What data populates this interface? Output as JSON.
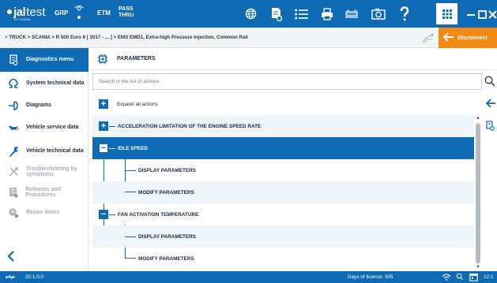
{
  "app": {
    "logo_main": "jal",
    "logo_rest": "test",
    "logo_sub": "BY CORAIL",
    "grp_label": "GRP",
    "etm_label": "ETM",
    "pass_line1": "PASS",
    "pass_line2": "THRU"
  },
  "toolbar_icons": [
    "globe-icon",
    "document-settings-icon",
    "list-icon",
    "print-icon",
    "battery-icon",
    "camera-icon",
    "help-icon",
    "grid-icon",
    "minimize-icon",
    "maximize-icon",
    "close-icon"
  ],
  "breadcrumb": {
    "prefix": "> ",
    "path": "TRUCK  >  SCANIA  >  R 500 Euro 6 [ 2017 - ... ]  >  EMS EMD1, Extra-high Pressure Injection, Common Rail"
  },
  "disconnect_label": "Disconnect",
  "sidebar": {
    "items": [
      {
        "label": "Diagnostics menu",
        "icon": "diagnostics-icon",
        "state": "active"
      },
      {
        "label": "System technical data",
        "icon": "ohm-icon",
        "state": "normal"
      },
      {
        "label": "Diagrams",
        "icon": "diagram-icon",
        "state": "normal"
      },
      {
        "label": "Vehicle service data",
        "icon": "oil-can-icon",
        "state": "normal"
      },
      {
        "label": "Vehicle technical data",
        "icon": "wrench-icon",
        "state": "normal"
      },
      {
        "label": "Troubleshooting by symptoms",
        "icon": "tools-icon",
        "state": "disabled"
      },
      {
        "label": "Releases and Procedures",
        "icon": "procedure-icon",
        "state": "disabled"
      },
      {
        "label": "Repair times",
        "icon": "clock-gear-icon",
        "state": "disabled"
      }
    ]
  },
  "main": {
    "title": "PARAMETERS",
    "search_placeholder": "Search in the list of actions",
    "expand_all": "Expand all actions",
    "tree": [
      {
        "label": "ACCELERATION LIMITATION OF THE ENGINE SPEED RATE",
        "expanded": false,
        "children": []
      },
      {
        "label": "IDLE SPEED",
        "expanded": true,
        "selected": true,
        "children": [
          "DISPLAY PARAMETERS",
          "MODIFY PARAMETERS"
        ]
      },
      {
        "label": "FAN ACTIVATION TEMPERATURE",
        "expanded": true,
        "children": [
          "DISPLAY PARAMETERS",
          "MODIFY PARAMETERS"
        ]
      }
    ]
  },
  "status": {
    "version": "20.1.0.0",
    "licence": "Days of licence: 305",
    "time": "12:1"
  },
  "colors": {
    "brand_blue": "#0e6ab5",
    "accent_orange": "#f28a14",
    "row_alt": "#eef5fb"
  }
}
